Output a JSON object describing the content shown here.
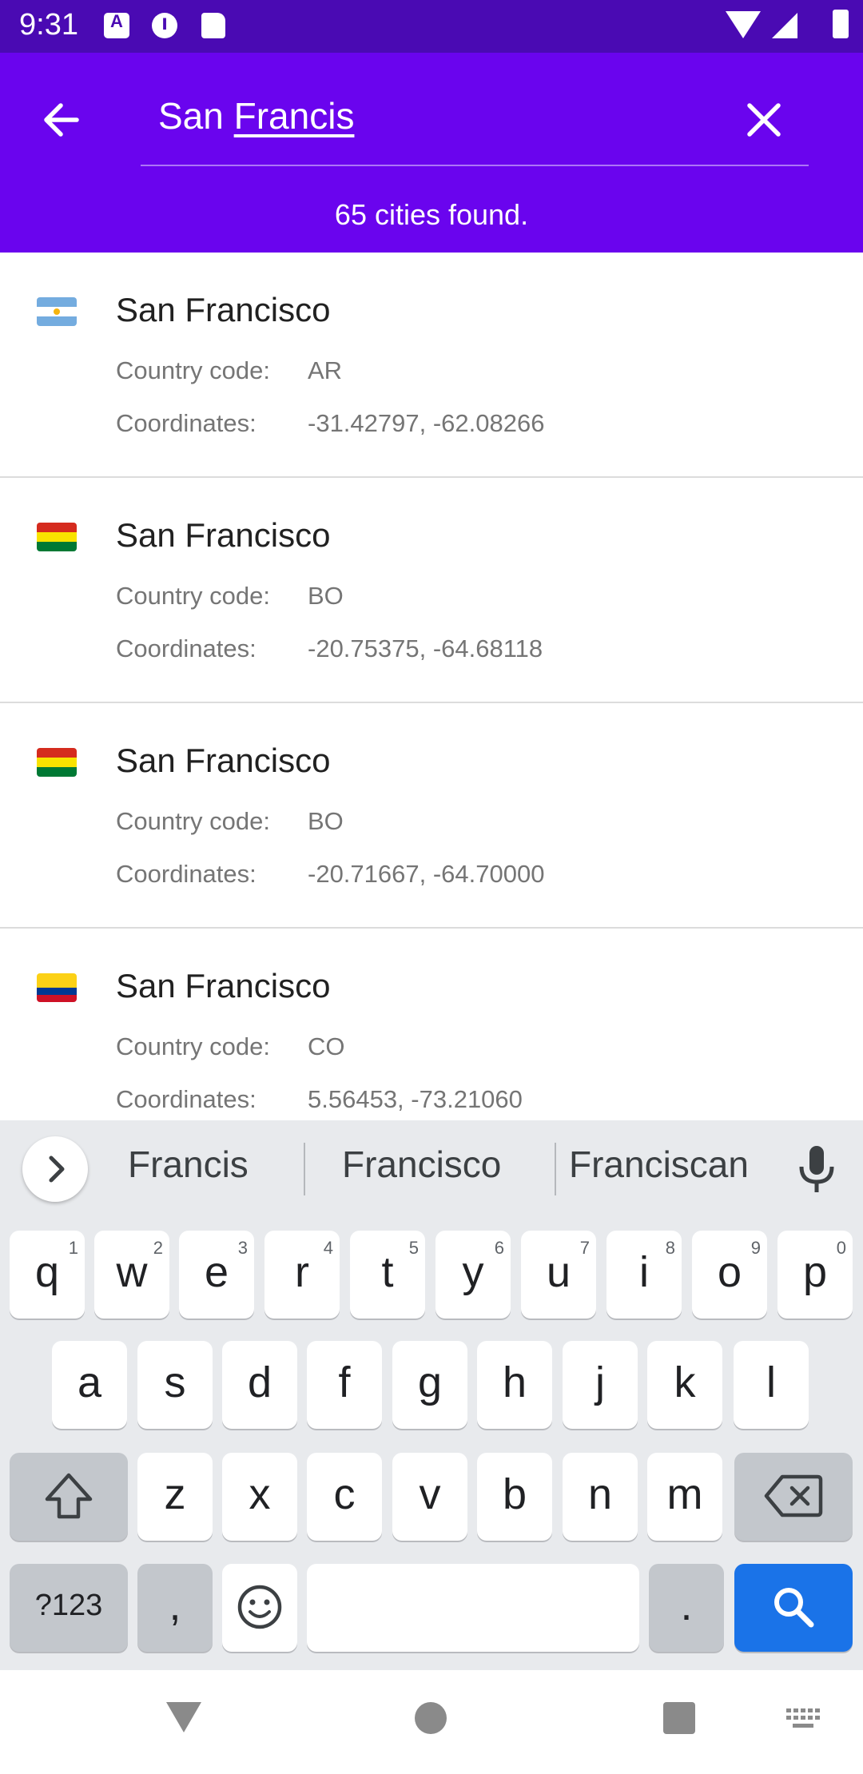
{
  "status_bar": {
    "time": "9:31"
  },
  "search": {
    "query_prefix": "San ",
    "query_composing": "Francis",
    "results_text": "65 cities found."
  },
  "cities": [
    {
      "name": "San Francisco",
      "flag": "AR",
      "code_label": "Country code:",
      "code": "AR",
      "coords_label": "Coordinates:",
      "coords": "-31.42797, -62.08266"
    },
    {
      "name": "San Francisco",
      "flag": "BO",
      "code_label": "Country code:",
      "code": "BO",
      "coords_label": "Coordinates:",
      "coords": "-20.75375, -64.68118"
    },
    {
      "name": "San Francisco",
      "flag": "BO",
      "code_label": "Country code:",
      "code": "BO",
      "coords_label": "Coordinates:",
      "coords": "-20.71667, -64.70000"
    },
    {
      "name": "San Francisco",
      "flag": "CO",
      "code_label": "Country code:",
      "code": "CO",
      "coords_label": "Coordinates:",
      "coords": "5.56453, -73.21060"
    }
  ],
  "keyboard": {
    "suggestions": [
      "Francis",
      "Francisco",
      "Franciscan"
    ],
    "row1": [
      {
        "k": "q",
        "h": "1"
      },
      {
        "k": "w",
        "h": "2"
      },
      {
        "k": "e",
        "h": "3"
      },
      {
        "k": "r",
        "h": "4"
      },
      {
        "k": "t",
        "h": "5"
      },
      {
        "k": "y",
        "h": "6"
      },
      {
        "k": "u",
        "h": "7"
      },
      {
        "k": "i",
        "h": "8"
      },
      {
        "k": "o",
        "h": "9"
      },
      {
        "k": "p",
        "h": "0"
      }
    ],
    "row2": [
      "a",
      "s",
      "d",
      "f",
      "g",
      "h",
      "j",
      "k",
      "l"
    ],
    "row3": [
      "z",
      "x",
      "c",
      "v",
      "b",
      "n",
      "m"
    ],
    "symbols_label": "?123",
    "comma": ",",
    "period": "."
  },
  "colors": {
    "status_bar": "#4a0ab3",
    "app_bar": "#6a04ee",
    "search_key": "#1a73e8"
  }
}
